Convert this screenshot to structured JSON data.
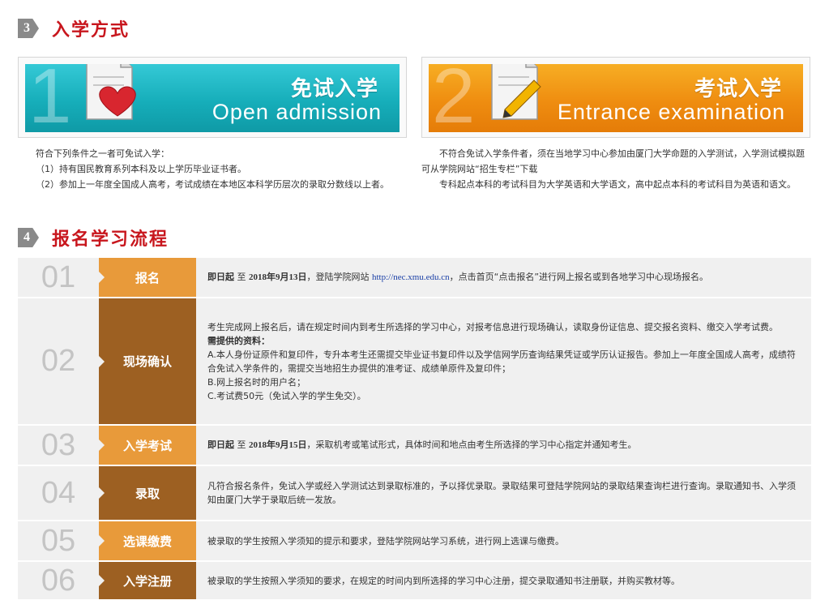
{
  "section3": {
    "num": "3",
    "title": "入学方式"
  },
  "section4": {
    "num": "4",
    "title": "报名学习流程"
  },
  "banners": [
    {
      "num": "1",
      "cn": "免试入学",
      "en": "Open admission",
      "icon": "document-heart-icon",
      "color": "#16aeba"
    },
    {
      "num": "2",
      "cn": "考试入学",
      "en": "Entrance examination",
      "icon": "document-pencil-icon",
      "color": "#ef8d10"
    }
  ],
  "left_desc": [
    "符合下列条件之一者可免试入学：",
    "（1）持有国民教育系列本科及以上学历毕业证书者。",
    "（2）参加上一年度全国成人高考，考试成绩在本地区本科学历层次的录取分数线以上者。"
  ],
  "right_desc": [
    "不符合免试入学条件者，须在当地学习中心参加由厦门大学命题的入学测试，入学测试模拟题可从学院网站“招生专栏”下载",
    "专科起点本科的考试科目为大学英语和大学语文，高中起点本科的考试科目为英语和语文。"
  ],
  "steps": [
    {
      "num": "01",
      "name": "报名",
      "shade": "light",
      "bold": "即日起",
      "mid": " 至 ",
      "date": "2018年9月13日",
      "pre": "，登陆学院网站 ",
      "link": "http://nec.xmu.edu.cn",
      "post": "，点击首页“点击报名”进行网上报名或到各地学习中心现场报名。"
    },
    {
      "num": "02",
      "name": "现场确认",
      "shade": "dark",
      "lines": [
        "考生完成网上报名后，请在规定时间内到考生所选择的学习中心，对报考信息进行现场确认，读取身份证信息、提交报名资料、缴交入学考试费。",
        "需提供的资料：",
        "A.本人身份证原件和复印件，专升本考生还需提交毕业证书复印件以及学信网学历查询结果凭证或学历认证报告。参加上一年度全国成人高考，成绩符合免试入学条件的，需提交当地招生办提供的准考证、成绩单原件及复印件；",
        "B.网上报名时的用户名；",
        "C.考试费50元（免试入学的学生免交）。"
      ]
    },
    {
      "num": "03",
      "name": "入学考试",
      "shade": "light",
      "bold": "即日起",
      "mid": " 至 ",
      "date": "2018年9月15日",
      "post": "，采取机考或笔试形式，具体时间和地点由考生所选择的学习中心指定并通知考生。"
    },
    {
      "num": "04",
      "name": "录取",
      "shade": "dark",
      "text": "凡符合报名条件，免试入学或经入学测试达到录取标准的，予以择优录取。录取结果可登陆学院网站的录取结果查询栏进行查询。录取通知书、入学须知由厦门大学于录取后统一发放。"
    },
    {
      "num": "05",
      "name": "选课缴费",
      "shade": "light",
      "text": "被录取的学生按照入学须知的提示和要求，登陆学院网站学习系统，进行网上选课与缴费。"
    },
    {
      "num": "06",
      "name": "入学注册",
      "shade": "dark",
      "text": "被录取的学生按照入学须知的要求，在规定的时间内到所选择的学习中心注册，提交录取通知书注册联，并购买教材等。"
    }
  ]
}
